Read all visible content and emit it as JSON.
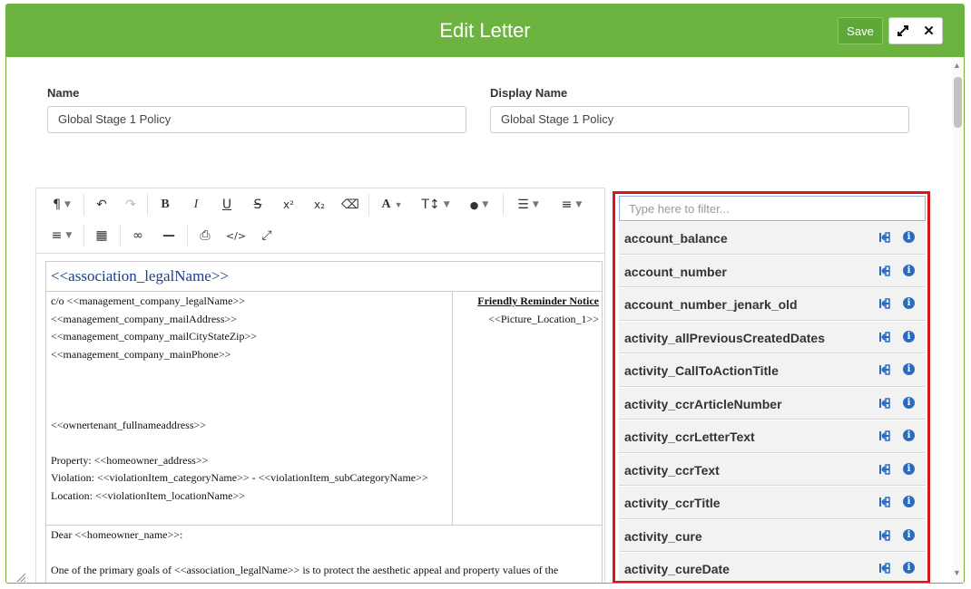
{
  "header": {
    "title": "Edit Letter",
    "save_label": "Save",
    "expand_icon": "expand-icon",
    "close_icon": "close-icon",
    "close_glyph": "✕"
  },
  "form": {
    "name_label": "Name",
    "name_value": "Global Stage 1  Policy",
    "display_name_label": "Display Name",
    "display_name_value": "Global Stage 1  Policy"
  },
  "toolbar": {
    "row1": [
      {
        "icon": "paragraph-icon",
        "glyph": "¶"
      },
      {
        "icon": "undo-icon",
        "glyph": "↶"
      },
      {
        "icon": "redo-icon",
        "glyph": "↷"
      },
      {
        "icon": "bold-icon",
        "glyph": "B"
      },
      {
        "icon": "italic-icon",
        "glyph": "I"
      },
      {
        "icon": "underline-icon",
        "glyph": "U"
      },
      {
        "icon": "strikethrough-icon",
        "glyph": "S"
      },
      {
        "icon": "superscript-icon",
        "glyph": "x²"
      },
      {
        "icon": "subscript-icon",
        "glyph": "x₂"
      },
      {
        "icon": "eraser-icon",
        "glyph": "⌫"
      },
      {
        "icon": "font-family-icon",
        "glyph": "A"
      },
      {
        "icon": "font-size-icon",
        "glyph": "T↕"
      },
      {
        "icon": "color-icon",
        "glyph": "●"
      },
      {
        "icon": "unordered-list-icon",
        "glyph": "☰"
      },
      {
        "icon": "ordered-list-icon",
        "glyph": "≡"
      }
    ],
    "row2": [
      {
        "icon": "align-icon",
        "glyph": "≡"
      },
      {
        "icon": "table-icon",
        "glyph": "▦"
      },
      {
        "icon": "link-icon",
        "glyph": "∞"
      },
      {
        "icon": "horizontal-rule-icon",
        "glyph": "—"
      },
      {
        "icon": "print-icon",
        "glyph": "⎙"
      },
      {
        "icon": "code-view-icon",
        "glyph": "</>"
      },
      {
        "icon": "fullscreen-icon",
        "glyph": "⤢"
      }
    ]
  },
  "document": {
    "title": "<<association_legalName>>",
    "left_lines": [
      "c/o <<management_company_legalName>>",
      "<<management_company_mailAddress>>",
      "<<management_company_mailCityStateZip>>",
      "<<management_company_mainPhone>>",
      "",
      "",
      "",
      "<<ownertenant_fullnameaddress>>",
      "",
      "Property: <<homeowner_address>>",
      "Violation: <<violationItem_categoryName>> - <<violationItem_subCategoryName>>",
      "Location: <<violationItem_locationName>>"
    ],
    "notice_title": "Friendly Reminder Notice",
    "picture_placeholder": "<<Picture_Location_1>>",
    "greeting": "Dear <<homeowner_name>>:",
    "body": "One of the primary goals of <<association_legalName>> is to protect the aesthetic appeal and property values of the"
  },
  "variables": {
    "filter_placeholder": "Type here to filter...",
    "items": [
      "account_balance",
      "account_number",
      "account_number_jenark_old",
      "activity_allPreviousCreatedDates",
      "activity_CallToActionTitle",
      "activity_ccrArticleNumber",
      "activity_ccrLetterText",
      "activity_ccrText",
      "activity_ccrTitle",
      "activity_cure",
      "activity_cureDate"
    ],
    "info_glyph": "i"
  },
  "colors": {
    "header": "#6cb33f",
    "panel_border": "#d9141b",
    "info": "#2a6bbf",
    "doc_title": "#1c3f8c"
  }
}
